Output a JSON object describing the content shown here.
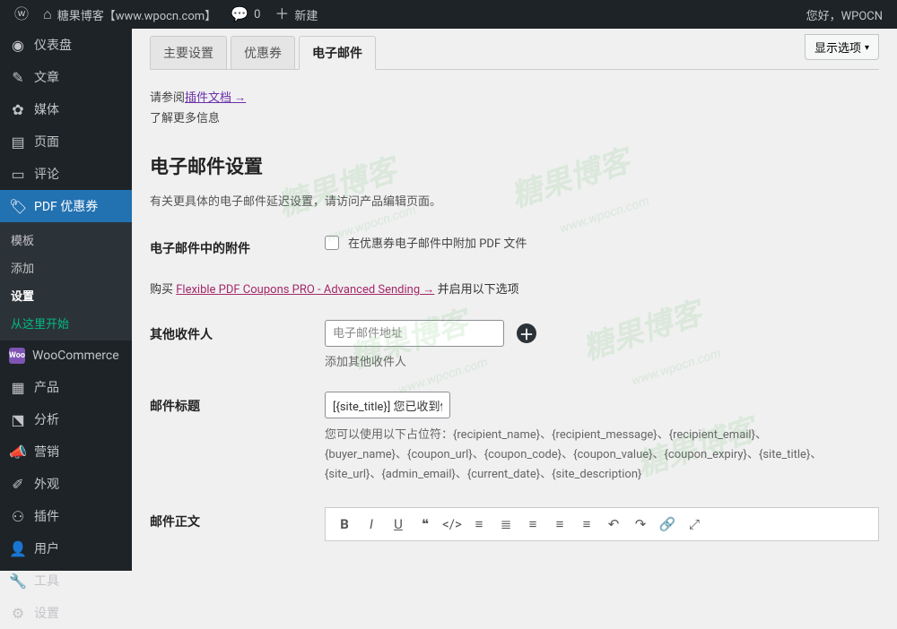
{
  "adminbar": {
    "site_title": "糖果博客【www.wpocn.com】",
    "comments_count": "0",
    "new_label": "新建",
    "greeting": "您好，WPOCN",
    "avatar_initial": ""
  },
  "sidebar": {
    "dashboard": "仪表盘",
    "posts": "文章",
    "media": "媒体",
    "pages": "页面",
    "comments": "评论",
    "pdf_coupons": "PDF 优惠券",
    "submenu": {
      "templates": "模板",
      "add": "添加",
      "settings": "设置",
      "start_here": "从这里开始"
    },
    "woocommerce": "WooCommerce",
    "woo_badge": "Woo",
    "products": "产品",
    "analytics": "分析",
    "marketing": "营销",
    "appearance": "外观",
    "plugins": "插件",
    "users": "用户",
    "tools": "工具",
    "settings_main": "设置"
  },
  "screen_options": "显示选项",
  "tabs": {
    "main": "主要设置",
    "coupons": "优惠券",
    "email": "电子邮件"
  },
  "doc": {
    "prefix": "请参阅",
    "link": "插件文档 →",
    "suffix": "了解更多信息"
  },
  "section": {
    "title": "电子邮件设置",
    "desc": "有关更具体的电子邮件延迟设置，请访问产品编辑页面。"
  },
  "rows": {
    "attachments": {
      "label": "电子邮件中的附件",
      "check_label": "在优惠券电子邮件中附加 PDF 文件"
    },
    "buy": {
      "prefix": "购买 ",
      "link": "Flexible PDF Coupons PRO - Advanced Sending →",
      "suffix": " 并启用以下选项"
    },
    "recipients": {
      "label": "其他收件人",
      "placeholder": "电子邮件地址",
      "helper": "添加其他收件人"
    },
    "subject": {
      "label": "邮件标题",
      "value": "[{site_title}] 您已收到优惠",
      "placeholders_text": "您可以使用以下占位符：{recipient_name}、{recipient_message}、{recipient_email}、{buyer_name}、{coupon_url}、{coupon_code}、{coupon_value}、{coupon_expiry}、{site_title}、{site_url}、{admin_email}、{current_date}、{site_description}"
    },
    "body": {
      "label": "邮件正文"
    }
  }
}
